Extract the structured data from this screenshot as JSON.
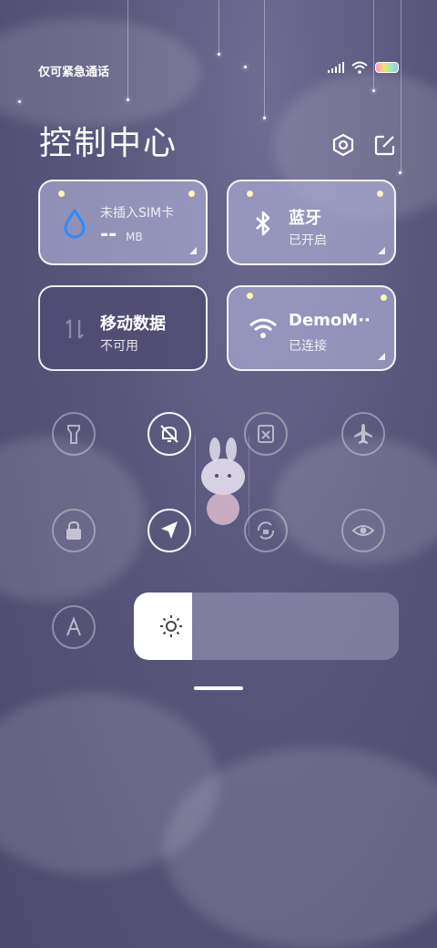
{
  "status_bar": {
    "carrier": "仅可紧急通话",
    "icons": [
      "signal-icon",
      "wifi-icon",
      "battery-icon"
    ]
  },
  "header": {
    "title": "控制中心",
    "icons": [
      "settings-icon",
      "edit-icon"
    ]
  },
  "tiles": {
    "sim": {
      "title": "未插入SIM卡",
      "value": "--",
      "unit": "MB",
      "icon": "water-drop-icon"
    },
    "bluetooth": {
      "title": "蓝牙",
      "status": "已开启",
      "icon": "bluetooth-icon"
    },
    "mobile_data": {
      "title": "移动数据",
      "status": "不可用",
      "icon": "data-arrows-icon"
    },
    "wifi": {
      "title": "DemoM··",
      "status": "已连接",
      "icon": "wifi-icon"
    }
  },
  "toggles": [
    {
      "name": "flashlight-icon",
      "active": false
    },
    {
      "name": "mute-bell-icon",
      "active": true
    },
    {
      "name": "screenshot-icon",
      "active": false
    },
    {
      "name": "airplane-icon",
      "active": false
    },
    {
      "name": "lock-icon",
      "active": false
    },
    {
      "name": "location-icon",
      "active": true
    },
    {
      "name": "rotation-lock-icon",
      "active": false
    },
    {
      "name": "eye-icon",
      "active": false
    },
    {
      "name": "auto-brightness-icon",
      "active": false
    }
  ],
  "brightness": {
    "level_fraction": 0.22,
    "icon": "sun-icon"
  },
  "colors": {
    "accent_blue": "#2d8cff",
    "tile_light": "#aaaad2",
    "tile_dark": "#504b73"
  }
}
